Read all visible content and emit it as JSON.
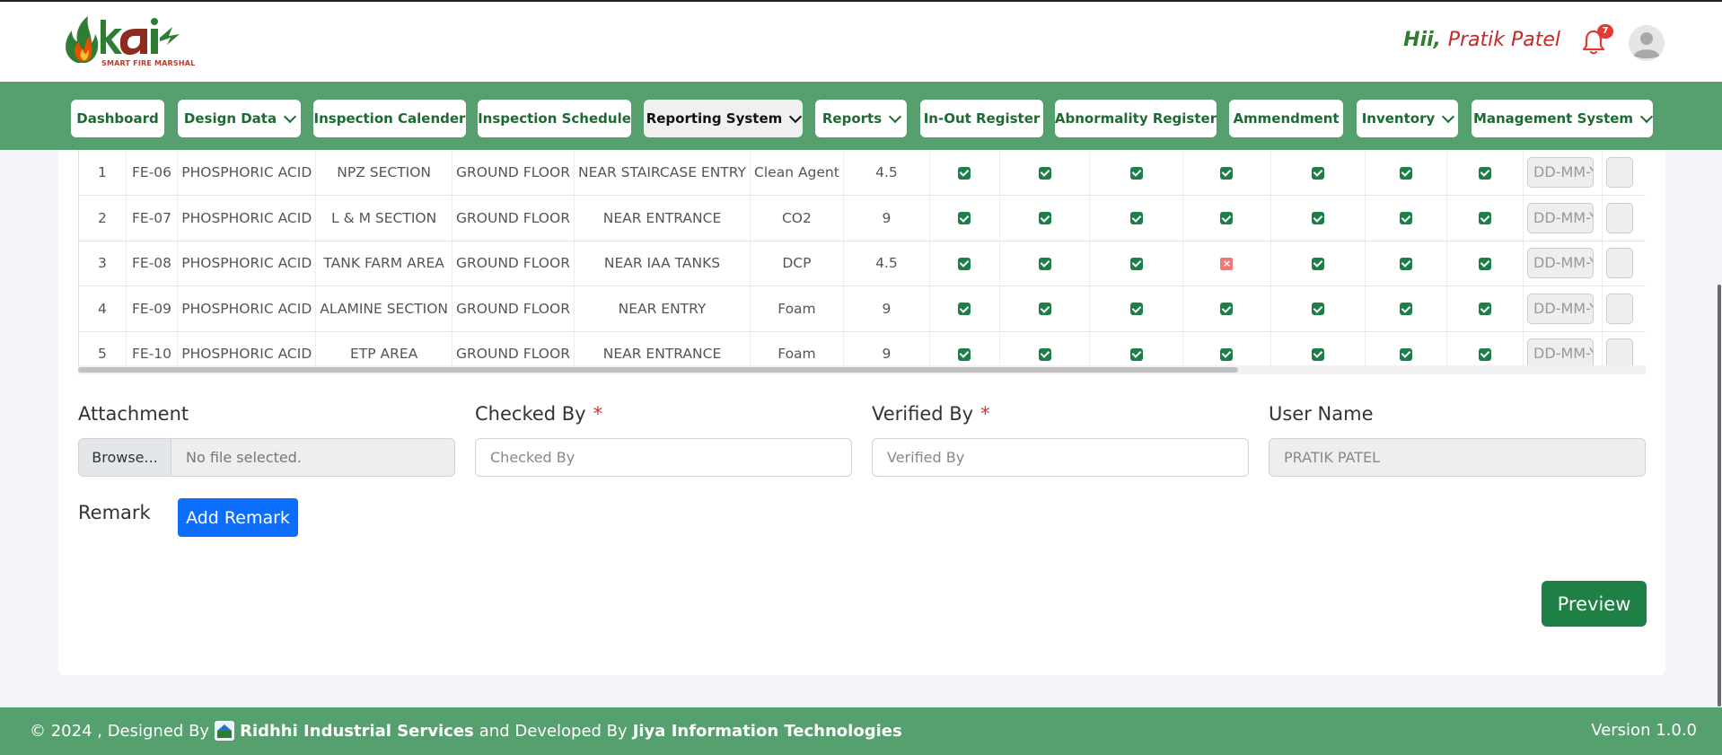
{
  "header": {
    "logo_text": "SMART FIRE MARSHAL",
    "greeting": "Hii,",
    "user_name": "Pratik Patel",
    "notification_count": "7"
  },
  "nav": [
    {
      "label": "Dashboard",
      "dropdown": false
    },
    {
      "label": "Design Data",
      "dropdown": true
    },
    {
      "label": "Inspection Calender",
      "dropdown": false
    },
    {
      "label": "Inspection Schedule",
      "dropdown": false
    },
    {
      "label": "Reporting System",
      "dropdown": true,
      "active": true
    },
    {
      "label": "Reports",
      "dropdown": true
    },
    {
      "label": "In-Out Register",
      "dropdown": false
    },
    {
      "label": "Abnormality Register",
      "dropdown": false
    },
    {
      "label": "Ammendment",
      "dropdown": false
    },
    {
      "label": "Inventory",
      "dropdown": true
    },
    {
      "label": "Management System",
      "dropdown": true
    }
  ],
  "table": {
    "rows": [
      {
        "no": "1",
        "id": "FE-06",
        "plant": "PHOSPHORIC ACID",
        "section": "NPZ SECTION",
        "floor": "GROUND FLOOR",
        "location": "NEAR STAIRCASE ENTRY",
        "type": "Clean Agent",
        "capacity": "4.5",
        "checks": [
          true,
          true,
          true,
          true,
          true,
          true,
          true
        ],
        "date_placeholder": "DD-MM-YYYY"
      },
      {
        "no": "2",
        "id": "FE-07",
        "plant": "PHOSPHORIC ACID",
        "section": "L & M SECTION",
        "floor": "GROUND FLOOR",
        "location": "NEAR ENTRANCE",
        "type": "CO2",
        "capacity": "9",
        "checks": [
          true,
          true,
          true,
          true,
          true,
          true,
          true
        ],
        "date_placeholder": "DD-MM-YYYY"
      },
      {
        "no": "3",
        "id": "FE-08",
        "plant": "PHOSPHORIC ACID",
        "section": "TANK FARM AREA",
        "floor": "GROUND FLOOR",
        "location": "NEAR IAA TANKS",
        "type": "DCP",
        "capacity": "4.5",
        "checks": [
          true,
          true,
          true,
          false,
          true,
          true,
          true
        ],
        "date_placeholder": "DD-MM-YYYY"
      },
      {
        "no": "4",
        "id": "FE-09",
        "plant": "PHOSPHORIC ACID",
        "section": "ALAMINE SECTION",
        "floor": "GROUND FLOOR",
        "location": "NEAR ENTRY",
        "type": "Foam",
        "capacity": "9",
        "checks": [
          true,
          true,
          true,
          true,
          true,
          true,
          true
        ],
        "date_placeholder": "DD-MM-YYYY"
      },
      {
        "no": "5",
        "id": "FE-10",
        "plant": "PHOSPHORIC ACID",
        "section": "ETP AREA",
        "floor": "GROUND FLOOR",
        "location": "NEAR ENTRANCE",
        "type": "Foam",
        "capacity": "9",
        "checks": [
          true,
          true,
          true,
          true,
          true,
          true,
          true
        ],
        "date_placeholder": "DD-MM-YYYY"
      }
    ]
  },
  "form": {
    "attachment_label": "Attachment",
    "browse_label": "Browse...",
    "file_status": "No file selected.",
    "checked_by_label": "Checked By",
    "checked_by_placeholder": "Checked By",
    "verified_by_label": "Verified By",
    "verified_by_placeholder": "Verified By",
    "required_mark": "*",
    "user_name_label": "User Name",
    "user_name_value": "PRATIK PATEL",
    "remark_label": "Remark",
    "add_remark_label": "Add Remark",
    "preview_label": "Preview"
  },
  "footer": {
    "copyright": "© 2024 , Designed By",
    "designer": "Ridhhi Industrial Services",
    "developed_by": "and Developed By",
    "developer": "Jiya Information Technologies",
    "version": "Version 1.0.0"
  },
  "colors": {
    "brand_green": "#55a06e",
    "dark_green": "#1e8045",
    "accent_red": "#c62828",
    "primary_blue": "#0d6efd"
  }
}
